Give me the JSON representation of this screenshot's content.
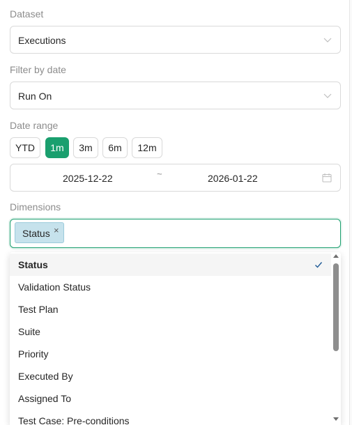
{
  "dataset": {
    "label": "Dataset",
    "value": "Executions"
  },
  "filter_by_date": {
    "label": "Filter by date",
    "value": "Run On"
  },
  "date_range": {
    "label": "Date range",
    "presets": [
      "YTD",
      "1m",
      "3m",
      "6m",
      "12m"
    ],
    "active_preset": "1m",
    "start": "2025-12-22",
    "separator": "~",
    "end": "2026-01-22"
  },
  "dimensions": {
    "label": "Dimensions",
    "selected_tags": [
      "Status"
    ],
    "tag_remove_glyph": "×",
    "options": [
      {
        "label": "Status",
        "selected": true
      },
      {
        "label": "Validation Status",
        "selected": false
      },
      {
        "label": "Test Plan",
        "selected": false
      },
      {
        "label": "Suite",
        "selected": false
      },
      {
        "label": "Priority",
        "selected": false
      },
      {
        "label": "Executed By",
        "selected": false
      },
      {
        "label": "Assigned To",
        "selected": false
      },
      {
        "label": "Test Case: Pre-conditions",
        "selected": false
      }
    ]
  },
  "colors": {
    "accent": "#1a9f6e",
    "tag_bg": "#c6e2ec",
    "label": "#8c8c8c"
  },
  "icons": {
    "select_arrow": "chevron-down-icon",
    "date_picker": "calendar-icon",
    "option_selected": "checkmark-icon"
  }
}
